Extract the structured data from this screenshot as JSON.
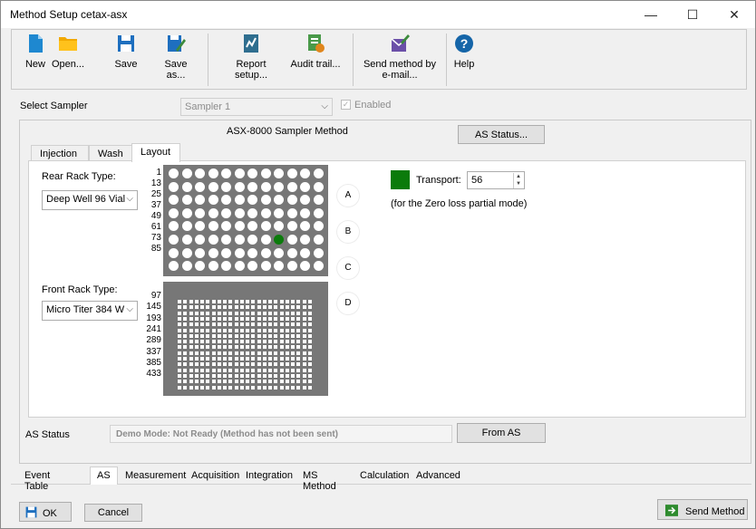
{
  "window": {
    "title": "Method Setup cetax-asx",
    "controls": {
      "minimize": "—",
      "maximize": "☐",
      "close": "✕"
    }
  },
  "toolbar": {
    "new": "New",
    "open": "Open...",
    "save": "Save",
    "save_as": "Save as...",
    "report_setup": "Report setup...",
    "audit_trail": "Audit trail...",
    "send_email_line1": "Send method by",
    "send_email_line2": "e-mail...",
    "help": "Help"
  },
  "sampler": {
    "label": "Select Sampler",
    "value": "Sampler 1",
    "enabled_label": "Enabled",
    "enabled_checked": true
  },
  "method": {
    "title": "ASX-8000 Sampler Method",
    "as_status_button": "AS Status..."
  },
  "tabs": {
    "injection": "Injection",
    "wash": "Wash",
    "layout": "Layout",
    "active": "Layout"
  },
  "layout": {
    "rear_label": "Rear Rack Type:",
    "rear_value": "Deep Well 96 Vial",
    "front_label": "Front Rack Type:",
    "front_value": "Micro Titer 384 W",
    "rear_row_labels": [
      "1",
      "13",
      "25",
      "37",
      "49",
      "61",
      "73",
      "85"
    ],
    "front_row_labels": [
      "97",
      "145",
      "193",
      "241",
      "289",
      "337",
      "385",
      "433"
    ],
    "rear_grid": {
      "rows": 8,
      "cols": 12,
      "selected_row": 5,
      "selected_col": 8
    },
    "front_grid": {
      "rows": 16,
      "cols": 24
    },
    "positions": [
      "A",
      "B",
      "C",
      "D"
    ],
    "transport_label": "Transport:",
    "transport_value": "56",
    "transport_note": "(for the Zero loss partial mode)",
    "colors": {
      "rack": "#777777",
      "selected": "#0b7b0b"
    }
  },
  "status": {
    "label": "AS Status",
    "value": "Demo Mode: Not Ready (Method has not been sent)",
    "from_as": "From AS"
  },
  "bottom_tabs": [
    "Event Table",
    "AS",
    "Measurement",
    "Acquisition",
    "Integration",
    "MS Method",
    "Calculation",
    "Advanced"
  ],
  "bottom_active": "AS",
  "footer": {
    "ok": "OK",
    "cancel": "Cancel",
    "send_method": "Send Method"
  }
}
